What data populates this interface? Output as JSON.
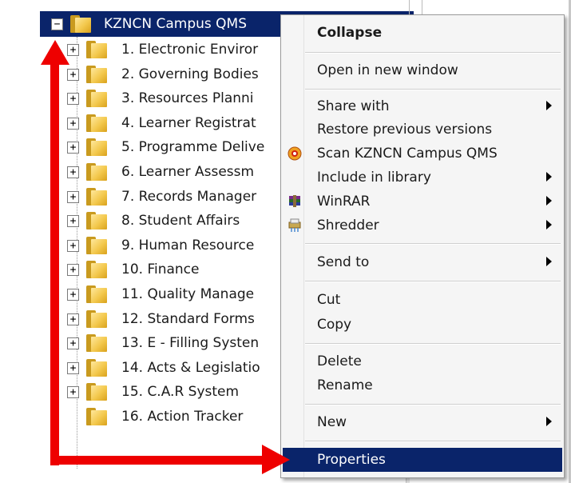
{
  "tree": {
    "root": {
      "label": "KZNCN Campus QMS",
      "expander": "−"
    },
    "items": [
      {
        "label": "1. Electronic Enviror",
        "expander": "+"
      },
      {
        "label": "2. Governing Bodies",
        "expander": "+"
      },
      {
        "label": "3. Resources Planni",
        "expander": "+"
      },
      {
        "label": "4. Learner Registrat",
        "expander": "+"
      },
      {
        "label": "5. Programme Delive",
        "expander": "+"
      },
      {
        "label": "6. Learner Assessm",
        "expander": "+"
      },
      {
        "label": "7. Records Manager",
        "expander": "+"
      },
      {
        "label": "8. Student Affairs",
        "expander": "+"
      },
      {
        "label": "9. Human Resource",
        "expander": "+"
      },
      {
        "label": "10. Finance",
        "expander": "+"
      },
      {
        "label": "11. Quality Manage",
        "expander": "+"
      },
      {
        "label": "12. Standard Forms",
        "expander": "+"
      },
      {
        "label": "13. E - Filling Systen",
        "expander": "+"
      },
      {
        "label": "14. Acts & Legislatio",
        "expander": "+"
      },
      {
        "label": "15. C.A.R System",
        "expander": "+"
      },
      {
        "label": "16. Action Tracker",
        "expander": ""
      }
    ]
  },
  "menu": {
    "collapse": "Collapse",
    "open_new_window": "Open in new window",
    "share_with": "Share with",
    "restore_previous": "Restore previous versions",
    "scan": "Scan KZNCN Campus QMS",
    "include_library": "Include in library",
    "winrar": "WinRAR",
    "shredder": "Shredder",
    "send_to": "Send to",
    "cut": "Cut",
    "copy": "Copy",
    "delete": "Delete",
    "rename": "Rename",
    "new": "New",
    "properties": "Properties"
  },
  "icons": {
    "tree_item": "folder-icon",
    "scan": "antivirus-scan-icon",
    "winrar": "winrar-icon",
    "shredder": "shredder-icon"
  },
  "colors": {
    "selection": "#0a246a",
    "annotation_arrow": "#ee0000",
    "folder": "#f3c84c"
  }
}
